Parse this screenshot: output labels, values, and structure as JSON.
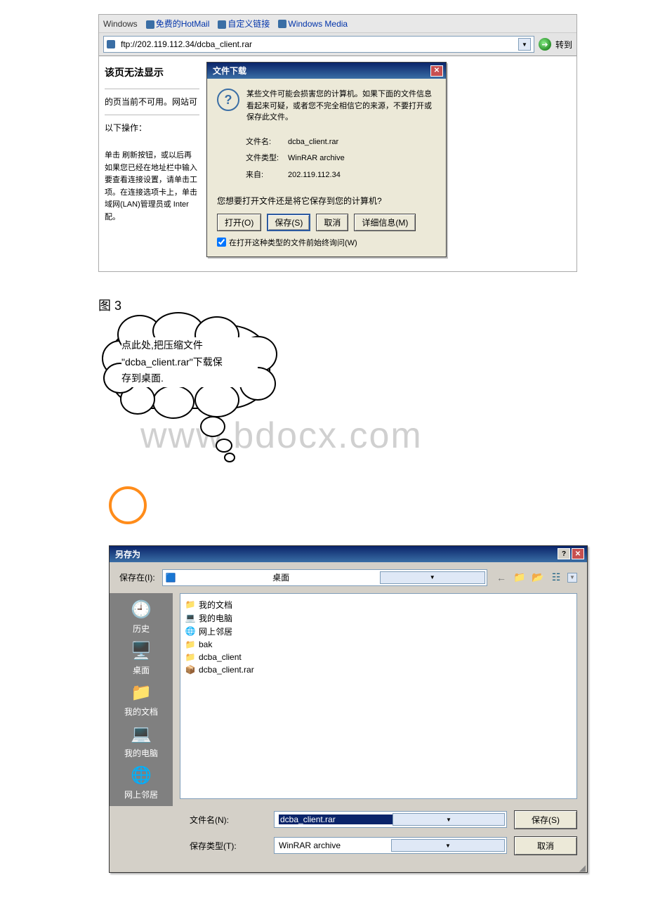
{
  "watermark": "www.bdocx.com",
  "links_bar": {
    "label": "Windows",
    "items": [
      "免费的HotMail",
      "自定义链接",
      "Windows Media"
    ]
  },
  "address_bar": {
    "url": "ftp://202.119.112.34/dcba_client.rar",
    "go_label": "转到"
  },
  "error_page": {
    "title": "该页无法显示",
    "line1": "的页当前不可用。网站可",
    "heading2": "以下操作：",
    "bullets": "单击 刷新按钮，或以后再\n如果您已经在地址栏中输入\n要查看连接设置，请单击工\n项。在连接选项卡上，单击\n域网(LAN)管理员或 Inter\n配。"
  },
  "download_dialog": {
    "title": "文件下载",
    "warning": "某些文件可能会损害您的计算机。如果下面的文件信息看起来可疑，或者您不完全相信它的来源，不要打开或保存此文件。",
    "filename_label": "文件名:",
    "filename": "dcba_client.rar",
    "filetype_label": "文件类型:",
    "filetype": "WinRAR archive",
    "from_label": "来自:",
    "from": "202.119.112.34",
    "prompt": "您想要打开文件还是将它保存到您的计算机?",
    "open": "打开(O)",
    "save": "保存(S)",
    "cancel": "取消",
    "more": "详细信息(M)",
    "always_ask": "在打开这种类型的文件前始终询问(W)"
  },
  "figure_label": "图 3",
  "cloud_text": {
    "l1": "点此处,把压缩文件",
    "l2": "\"dcba_client.rar\"下载保",
    "l3": "存到桌面."
  },
  "save_dialog": {
    "title": "另存为",
    "save_in_label": "保存在(I):",
    "save_in_value": "桌面",
    "places": [
      "历史",
      "桌面",
      "我的文档",
      "我的电脑",
      "网上邻居"
    ],
    "items": [
      {
        "icon": "📁",
        "name": "我的文档"
      },
      {
        "icon": "💻",
        "name": "我的电脑"
      },
      {
        "icon": "🌐",
        "name": "网上邻居"
      },
      {
        "icon": "📁",
        "name": "bak"
      },
      {
        "icon": "📁",
        "name": "dcba_client"
      },
      {
        "icon": "📦",
        "name": "dcba_client.rar"
      }
    ],
    "filename_label": "文件名(N):",
    "filename": "dcba_client.rar",
    "filetype_label": "保存类型(T):",
    "filetype": "WinRAR archive",
    "save": "保存(S)",
    "cancel": "取消"
  }
}
